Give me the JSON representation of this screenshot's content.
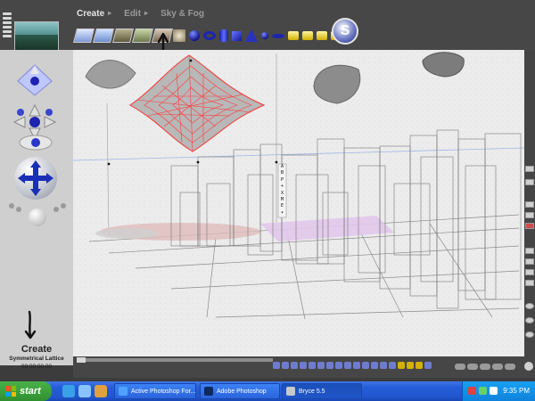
{
  "menu": {
    "create": "Create",
    "edit": "Edit",
    "sky_fog": "Sky & Fog"
  },
  "status": {
    "mode": "Create",
    "object_name": "Symmetrical Lattice",
    "time": "00:00:00.00"
  },
  "viewport": {
    "toolbox_items": [
      "A",
      "B",
      "P",
      "+",
      "X",
      "M",
      "E",
      "▾"
    ]
  },
  "taskbar": {
    "start_label": "start",
    "tasks": [
      "Active Photoshop For...",
      "Adobe Photoshop",
      "Bryce 5.5"
    ],
    "clock": "9:35 PM"
  },
  "colors": {
    "wireframe_red": "#ff3a3a",
    "primitive_blue": "#1d24b0",
    "panel_gray": "#cfcfcf",
    "viewport_bg": "#ededed",
    "xp_blue": "#245ed9",
    "start_green": "#3ca33c"
  },
  "icons": {
    "logo": "bryce-logo-icon",
    "cursor": "arrow-cursor-icon",
    "start": "windows-flag-icon"
  }
}
